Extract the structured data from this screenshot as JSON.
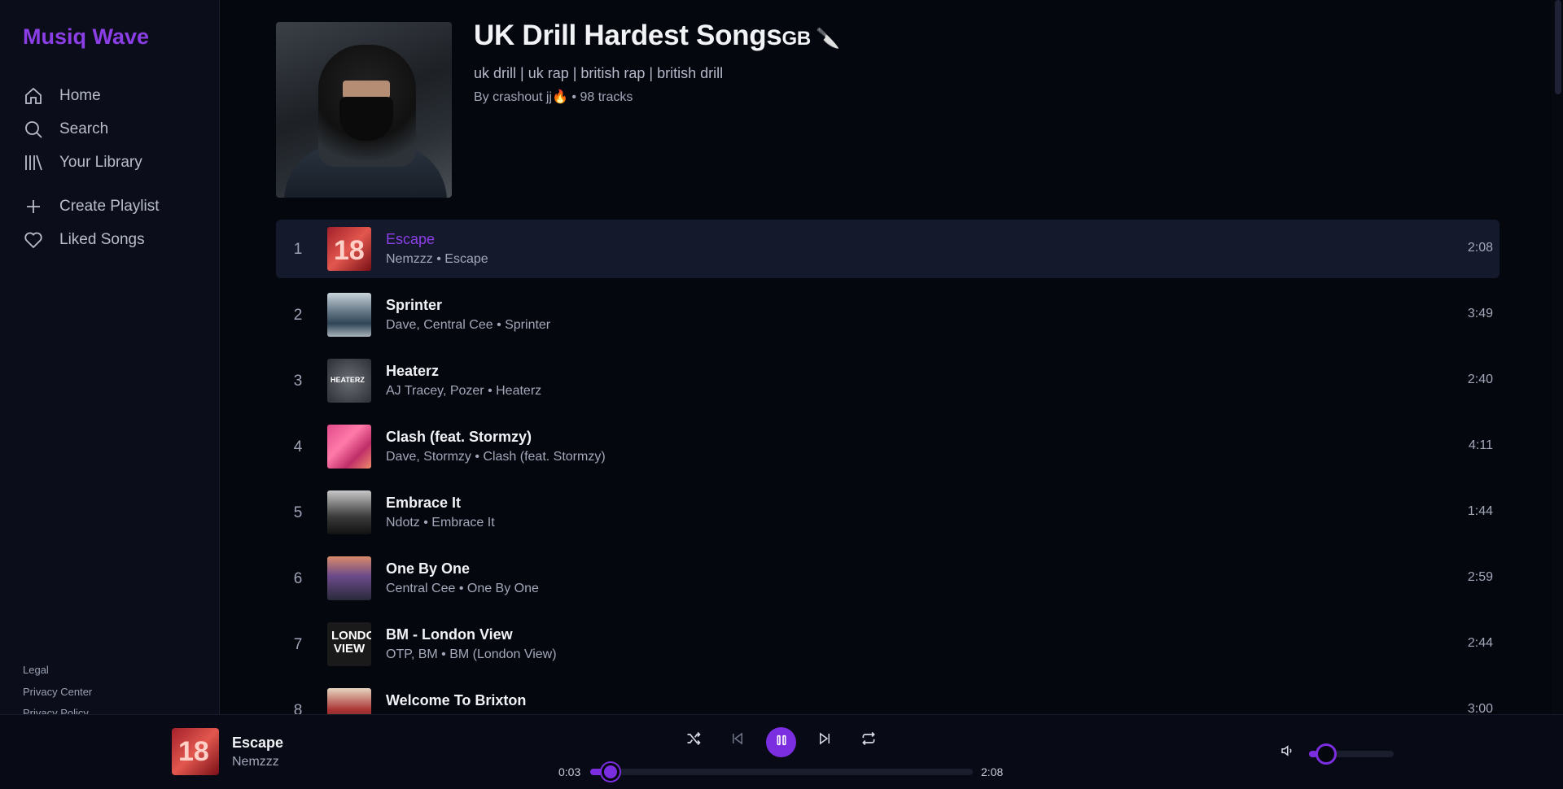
{
  "app": {
    "name": "Musiq Wave"
  },
  "sidebar": {
    "nav": [
      {
        "label": "Home",
        "icon": "home-icon"
      },
      {
        "label": "Search",
        "icon": "search-icon"
      },
      {
        "label": "Your Library",
        "icon": "library-icon"
      }
    ],
    "actions": [
      {
        "label": "Create Playlist",
        "icon": "plus-icon"
      },
      {
        "label": "Liked Songs",
        "icon": "heart-icon"
      }
    ],
    "legal": [
      "Legal",
      "Privacy Center",
      "Privacy Policy"
    ]
  },
  "playlist": {
    "title": "UK Drill Hardest Songs",
    "title_suffix": "GB 🔪",
    "tags": "uk drill | uk rap | british rap | british drill",
    "owner": "By crashout jj🔥",
    "track_count": "• 98 tracks"
  },
  "tracks": [
    {
      "num": "1",
      "title": "Escape",
      "subtitle": "Nemzzz • Escape",
      "duration": "2:08",
      "active": true,
      "art_text": "18"
    },
    {
      "num": "2",
      "title": "Sprinter",
      "subtitle": "Dave, Central Cee • Sprinter",
      "duration": "3:49"
    },
    {
      "num": "3",
      "title": "Heaterz",
      "subtitle": "AJ Tracey, Pozer • Heaterz",
      "duration": "2:40",
      "art_text": "HEATERZ"
    },
    {
      "num": "4",
      "title": "Clash (feat. Stormzy)",
      "subtitle": "Dave, Stormzy • Clash (feat. Stormzy)",
      "duration": "4:11"
    },
    {
      "num": "5",
      "title": "Embrace It",
      "subtitle": "Ndotz • Embrace It",
      "duration": "1:44"
    },
    {
      "num": "6",
      "title": "One By One",
      "subtitle": "Central Cee • One By One",
      "duration": "2:59"
    },
    {
      "num": "7",
      "title": "BM - London View",
      "subtitle": "OTP, BM • BM (London View)",
      "duration": "2:44",
      "art_text": "LONDON VIEW"
    },
    {
      "num": "8",
      "title": "Welcome To Brixton",
      "subtitle": "",
      "duration": "3:00"
    }
  ],
  "player": {
    "title": "Escape",
    "artist": "Nemzzz",
    "current_time": "0:03",
    "total_time": "2:08",
    "progress": 0.024,
    "volume": 0.1,
    "accent": "#7b2de0"
  }
}
